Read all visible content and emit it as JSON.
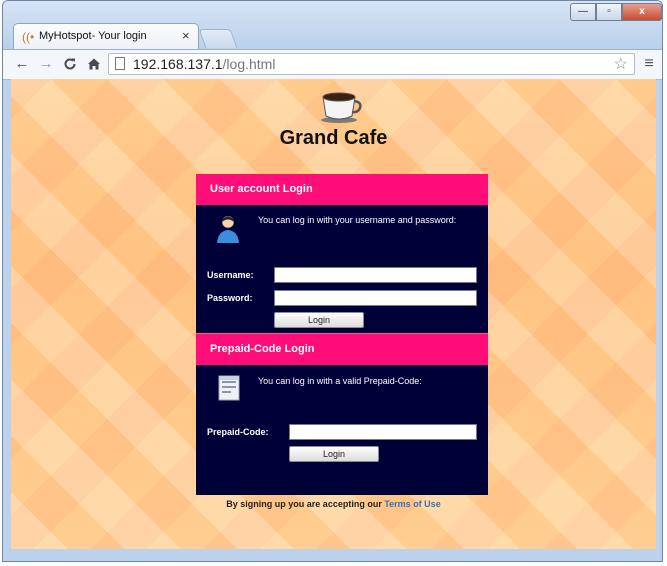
{
  "browser": {
    "tab_title": "MyHotspot- Your login",
    "url_host": "192.168.137.1",
    "url_path": "/log.html",
    "window_buttons": {
      "minimize": "—",
      "maximize": "▫",
      "close": "x"
    }
  },
  "page": {
    "cafe_name": "Grand Cafe",
    "user_login": {
      "header": "User account Login",
      "info": "You can log in with  your username  and password:",
      "username_label": "Username:",
      "password_label": "Password:",
      "button": "Login"
    },
    "prepaid_login": {
      "header": "Prepaid-Code Login",
      "info": "You can log in with a valid Prepaid-Code:",
      "code_label": "Prepaid-Code:",
      "button": "Login"
    },
    "footer_text": "By signing up you are accepting our",
    "terms_link": "Terms of Use"
  },
  "colors": {
    "panel_bg": "#000038",
    "panel_header": "#ff0d78",
    "link": "#3d6fb3"
  }
}
